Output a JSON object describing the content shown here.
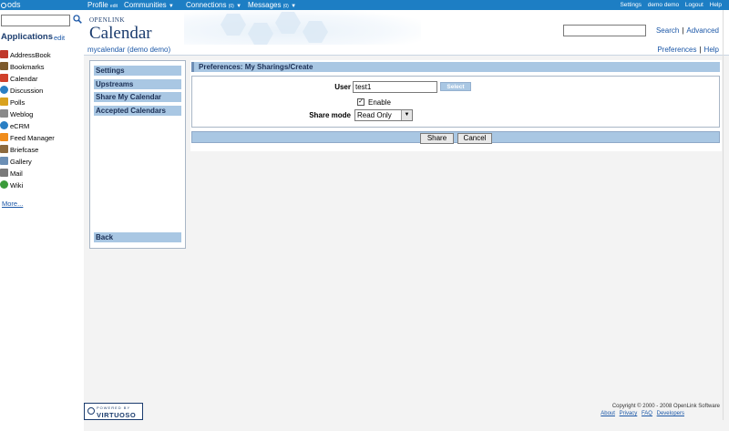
{
  "topbar": {
    "logo": "ods",
    "profile": "Profile",
    "profile_edit": "edit",
    "communities": "Communities",
    "connections": "Connections",
    "connections_count": "(0)",
    "messages": "Messages",
    "messages_count": "(0)",
    "right_links": [
      "Settings",
      "demo demo",
      "Logout",
      "Help"
    ]
  },
  "sidebar": {
    "title": "Applications",
    "edit": "edit",
    "apps": [
      {
        "label": "AddressBook",
        "icon": "addressbook-icon",
        "color": "#c0392b"
      },
      {
        "label": "Bookmarks",
        "icon": "bookmarks-icon",
        "color": "#7d5a2c"
      },
      {
        "label": "Calendar",
        "icon": "calendar-icon",
        "color": "#d0402a"
      },
      {
        "label": "Discussion",
        "icon": "discussion-icon",
        "color": "#2a7fc4"
      },
      {
        "label": "Polls",
        "icon": "polls-icon",
        "color": "#d9a21f"
      },
      {
        "label": "Weblog",
        "icon": "weblog-icon",
        "color": "#8a8a8a"
      },
      {
        "label": "eCRM",
        "icon": "ecrm-icon",
        "color": "#2a7fc4"
      },
      {
        "label": "Feed Manager",
        "icon": "feed-icon",
        "color": "#f08c1c"
      },
      {
        "label": "Briefcase",
        "icon": "briefcase-icon",
        "color": "#8c6a3e"
      },
      {
        "label": "Gallery",
        "icon": "gallery-icon",
        "color": "#6c8fb5"
      },
      {
        "label": "Mail",
        "icon": "mail-icon",
        "color": "#7a7a7a"
      },
      {
        "label": "Wiki",
        "icon": "wiki-icon",
        "color": "#3a9b3a"
      }
    ],
    "more": "More..."
  },
  "header": {
    "brand_small": "OPENLINK",
    "brand_title": "Calendar",
    "search": "Search",
    "advanced": "Advanced",
    "breadcrumb": "mycalendar (demo demo)",
    "preferences": "Preferences",
    "help": "Help"
  },
  "menu": {
    "items": [
      "Settings",
      "Upstreams",
      "Share My Calendar",
      "Accepted Calendars"
    ],
    "back": "Back"
  },
  "form": {
    "title": "Preferences: My Sharings/Create",
    "user_label": "User",
    "user_value": "test1",
    "select_button": "Select",
    "enable_label": "Enable",
    "enable_checked": true,
    "share_mode_label": "Share mode",
    "share_mode_value": "Read Only",
    "share_button": "Share",
    "cancel_button": "Cancel"
  },
  "footer": {
    "powered_by": "POWERED BY",
    "virtuoso": "VIRTUOSO",
    "copyright": "Copyright © 2000 - 2008 OpenLink Software",
    "links": [
      "About",
      "Privacy",
      "FAQ",
      "Developers"
    ]
  }
}
